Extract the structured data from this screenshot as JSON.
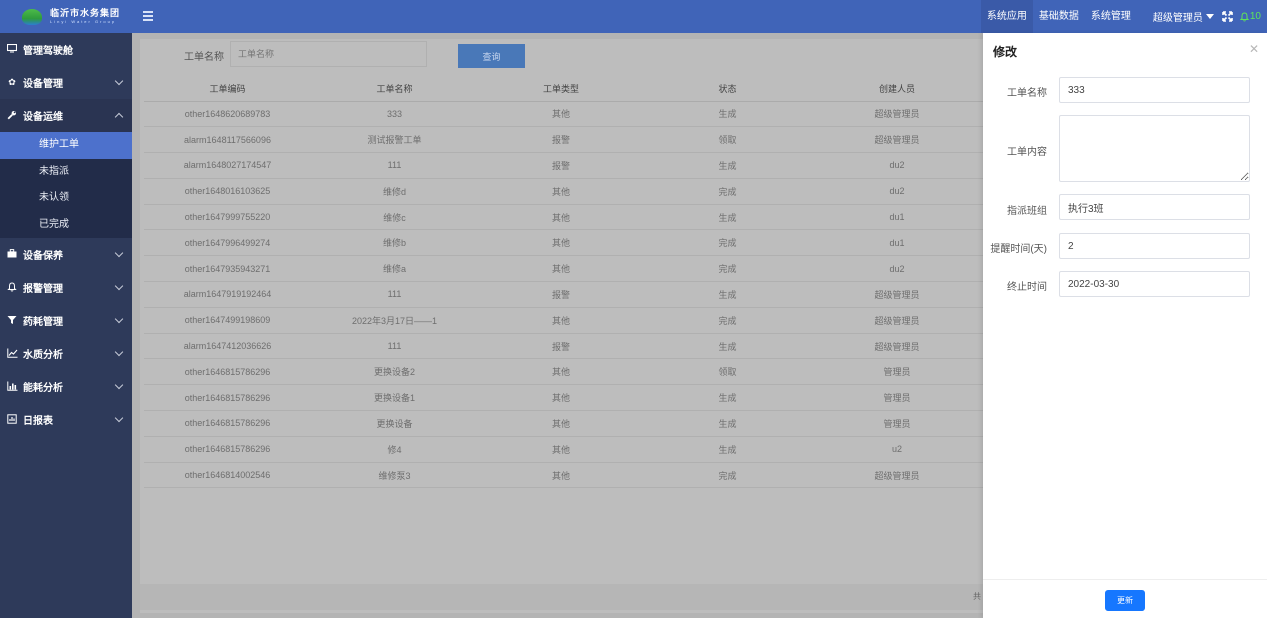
{
  "header": {
    "logo_cn": "临沂市水务集团",
    "logo_en": "Linyi Water Group",
    "nav": [
      "系统应用",
      "基础数据",
      "系统管理"
    ],
    "active_nav": 0,
    "user": "超级管理员",
    "notifications": "10",
    "accent": "#4064b8"
  },
  "sidebar": {
    "items": [
      {
        "icon": "monitor-icon",
        "label": "管理驾驶舱"
      },
      {
        "icon": "gear-icon",
        "label": "设备管理"
      },
      {
        "icon": "wrench-icon",
        "label": "设备运维"
      },
      {
        "icon": "briefcase-icon",
        "label": "设备保养"
      },
      {
        "icon": "bell-icon",
        "label": "报警管理"
      },
      {
        "icon": "filter-icon",
        "label": "药耗管理"
      },
      {
        "icon": "line-chart-icon",
        "label": "水质分析"
      },
      {
        "icon": "bar-chart-icon",
        "label": "能耗分析"
      },
      {
        "icon": "report-icon",
        "label": "日报表"
      }
    ],
    "sub_items": [
      "维护工单",
      "未指派",
      "未认领",
      "已完成"
    ],
    "active_sub": 0
  },
  "search": {
    "label": "工单名称",
    "placeholder": "工单名称",
    "button": "查询"
  },
  "table": {
    "headers": [
      "工单编码",
      "工单名称",
      "工单类型",
      "状态",
      "创建人员"
    ],
    "rows": [
      [
        "other1648620689783",
        "333",
        "其他",
        "生成",
        "超级管理员"
      ],
      [
        "alarm1648117566096",
        "测试报警工单",
        "报警",
        "领取",
        "超级管理员"
      ],
      [
        "alarm1648027174547",
        "111",
        "报警",
        "生成",
        "du2"
      ],
      [
        "other1648016103625",
        "维修d",
        "其他",
        "完成",
        "du2"
      ],
      [
        "other1647999755220",
        "维修c",
        "其他",
        "生成",
        "du1"
      ],
      [
        "other1647996499274",
        "维修b",
        "其他",
        "完成",
        "du1"
      ],
      [
        "other1647935943271",
        "维修a",
        "其他",
        "完成",
        "du2"
      ],
      [
        "alarm1647919192464",
        "111",
        "报警",
        "生成",
        "超级管理员"
      ],
      [
        "other1647499198609",
        "2022年3月17日——1",
        "其他",
        "完成",
        "超级管理员"
      ],
      [
        "alarm1647412036626",
        "111",
        "报警",
        "生成",
        "超级管理员"
      ],
      [
        "other1646815786296",
        "更换设备2",
        "其他",
        "领取",
        "管理员"
      ],
      [
        "other1646815786296",
        "更换设备1",
        "其他",
        "生成",
        "管理员"
      ],
      [
        "other1646815786296",
        "更换设备",
        "其他",
        "生成",
        "管理员"
      ],
      [
        "other1646815786296",
        "修4",
        "其他",
        "生成",
        "u2"
      ],
      [
        "other1646814002546",
        "维修泵3",
        "其他",
        "完成",
        "超级管理员"
      ]
    ]
  },
  "pager": {
    "text": "共"
  },
  "drawer": {
    "title": "修改",
    "fields": {
      "name_label": "工单名称",
      "name_value": "333",
      "content_label": "工单内容",
      "content_value": "",
      "team_label": "指派班组",
      "team_value": "执行3班",
      "remind_label": "提醒时间(天)",
      "remind_value": "2",
      "end_label": "终止时间",
      "end_value": "2022-03-30"
    },
    "update_button": "更新"
  }
}
